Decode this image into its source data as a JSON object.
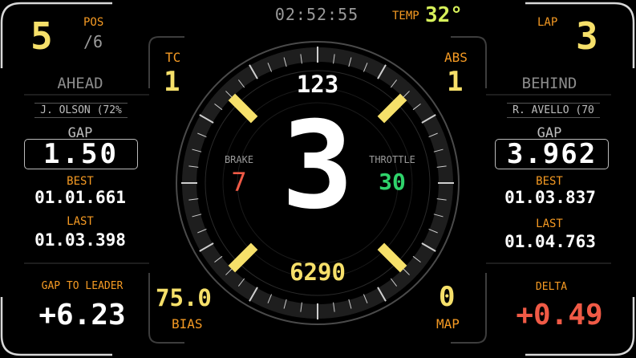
{
  "top": {
    "clock": "02:52:55",
    "temp_label": "TEMP",
    "temp_value": "32°"
  },
  "left": {
    "position": "5",
    "pos_label": "POS",
    "pos_total": "/6",
    "ahead_label": "AHEAD",
    "ahead_driver": "J. OLSON (72%",
    "gap_label": "GAP",
    "gap_value": "1.50",
    "best_label": "BEST",
    "best_value": "01.01.661",
    "last_label": "LAST",
    "last_value": "01.03.398",
    "gap_leader_label": "GAP TO LEADER",
    "gap_leader_value": "+6.23"
  },
  "right": {
    "lap_label": "LAP",
    "lap_value": "3",
    "behind_label": "BEHIND",
    "behind_driver": "R. AVELLO (70",
    "gap_label": "GAP",
    "gap_value": "3.962",
    "best_label": "BEST",
    "best_value": "01.03.837",
    "last_label": "LAST",
    "last_value": "01.04.763",
    "delta_label": "DELTA",
    "delta_value": "+0.49"
  },
  "gauge": {
    "tc_label": "TC",
    "tc_value": "1",
    "abs_label": "ABS",
    "abs_value": "1",
    "speed": "123",
    "gear": "3",
    "brake_label": "BRAKE",
    "brake_value": "7",
    "throttle_label": "THROTTLE",
    "throttle_value": "30",
    "rpm": "6290",
    "bias_value": "75.0",
    "bias_label": "BIAS",
    "map_value": "0",
    "map_label": "MAP"
  },
  "colors": {
    "orange": "#f59a23",
    "yellow": "#f6e06a",
    "red": "#f05a46",
    "green": "#2fd36b"
  }
}
